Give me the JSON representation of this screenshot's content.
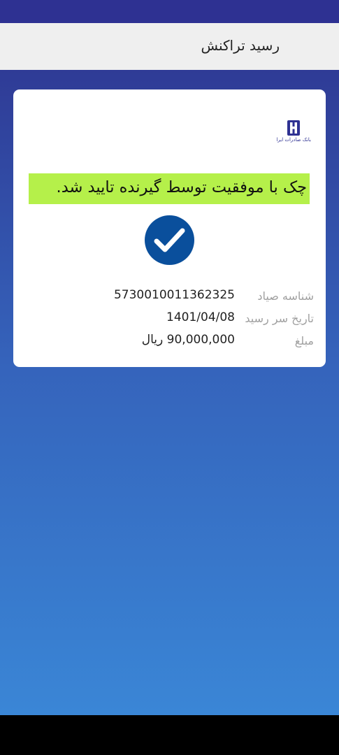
{
  "header": {
    "title": "رسید تراکنش"
  },
  "bank": {
    "logo_text": "بانک صادرات ایران"
  },
  "message": "چک با موفقیت توسط گیرنده تایید شد.",
  "details": [
    {
      "label": "شناسه صیاد",
      "value": "5730010011362325"
    },
    {
      "label": "تاریخ سر رسید",
      "value": "1401/04/08"
    },
    {
      "label": "مبلغ",
      "value": "90,000,000 ریال"
    }
  ],
  "colors": {
    "primary": "#2e3192",
    "highlight": "#b5f04a",
    "success_circle": "#0a4f9c",
    "gradient_top": "#2f3b96",
    "gradient_bottom": "#3a86d6"
  }
}
